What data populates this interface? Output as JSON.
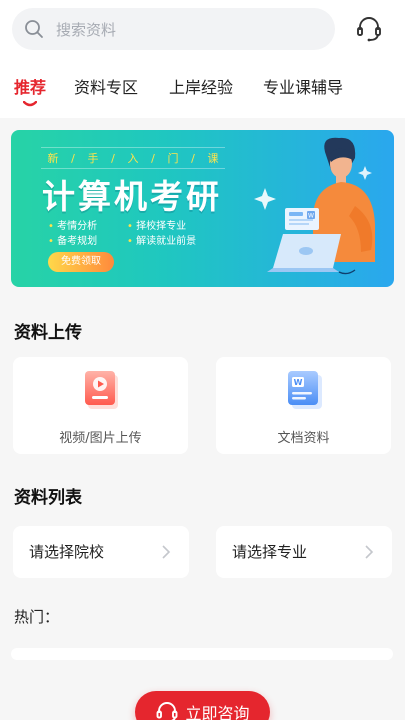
{
  "search": {
    "placeholder": "搜索资料",
    "icon": "search-icon"
  },
  "header": {
    "support_icon": "headset-icon"
  },
  "tabs": [
    {
      "label": "推荐",
      "active": true
    },
    {
      "label": "资料专区",
      "active": false
    },
    {
      "label": "上岸经验",
      "active": false
    },
    {
      "label": "专业课辅导",
      "active": false
    }
  ],
  "banner": {
    "tag_chars": [
      "新",
      "手",
      "入",
      "门",
      "课"
    ],
    "title": "计算机考研",
    "features": [
      "考情分析",
      "择校择专业",
      "备考规划",
      "解读就业前景"
    ],
    "button": "免费领取",
    "doc_badge": "W"
  },
  "upload": {
    "title": "资料上传",
    "items": [
      {
        "label": "视频/图片上传",
        "icon": "video-upload-icon"
      },
      {
        "label": "文档资料",
        "icon": "word-document-icon"
      }
    ]
  },
  "list": {
    "title": "资料列表",
    "selectors": [
      {
        "label": "请选择院校"
      },
      {
        "label": "请选择专业"
      }
    ]
  },
  "hot": {
    "label": "热门："
  },
  "consult": {
    "label": "立即咨询"
  },
  "colors": {
    "accent": "#e5262e",
    "banner_start": "#27d3a6",
    "banner_end": "#2aa7ee"
  }
}
